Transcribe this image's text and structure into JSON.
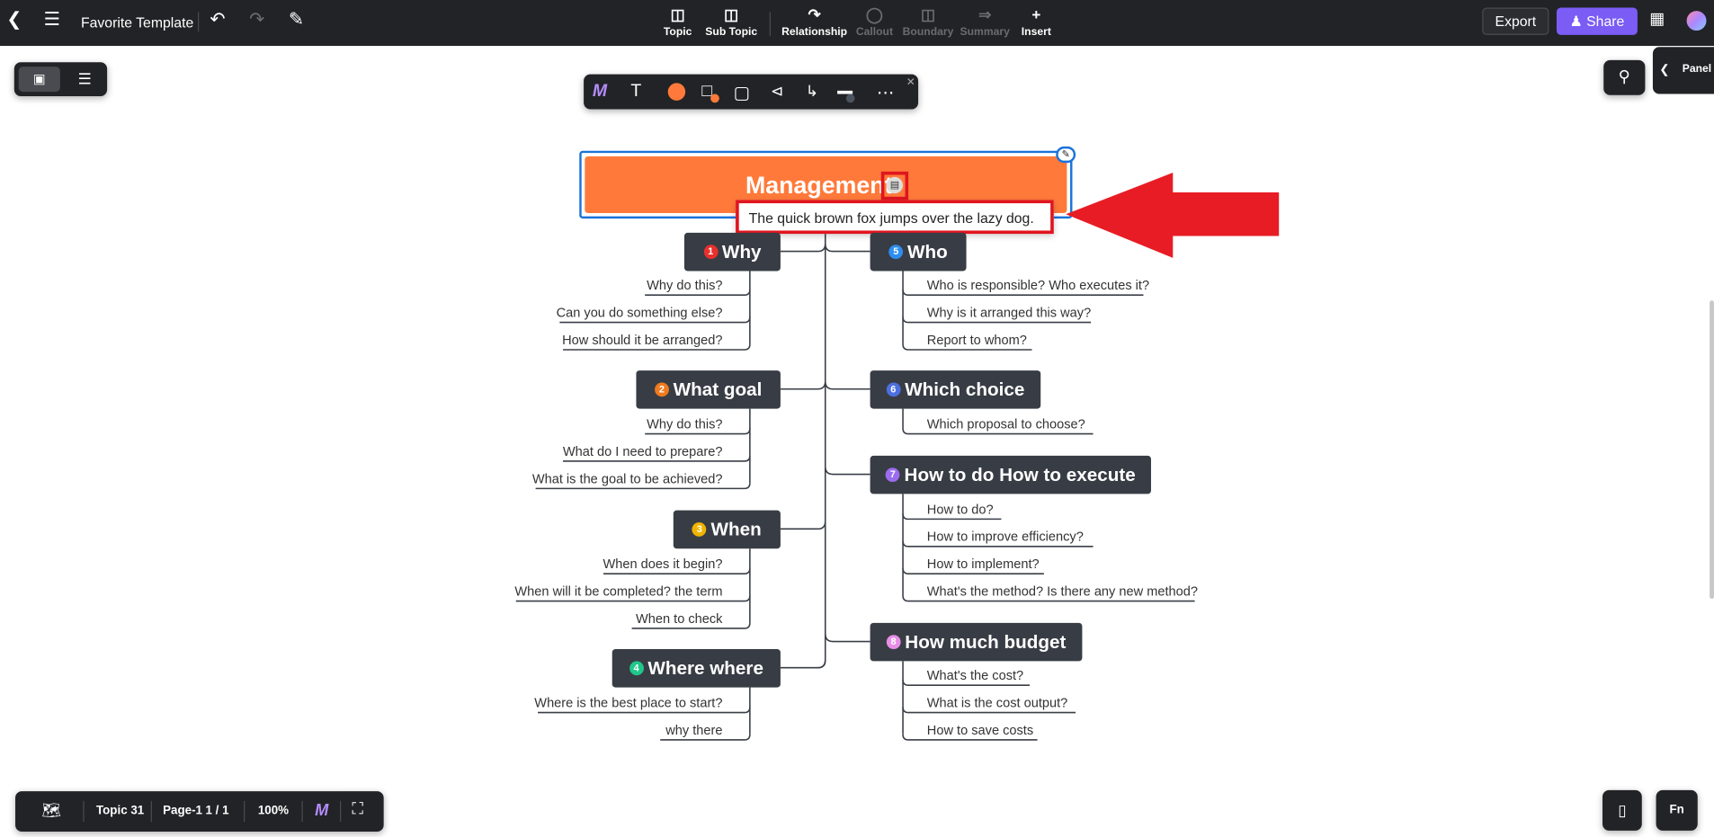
{
  "topbar": {
    "title": "Favorite Template",
    "tools": [
      {
        "label": "Topic",
        "icon": "topic-icon",
        "disabled": false
      },
      {
        "label": "Sub Topic",
        "icon": "subtopic-icon",
        "disabled": false
      },
      {
        "label": "Relationship",
        "icon": "relationship-icon",
        "disabled": false
      },
      {
        "label": "Callout",
        "icon": "callout-icon",
        "disabled": true
      },
      {
        "label": "Boundary",
        "icon": "boundary-icon",
        "disabled": true
      },
      {
        "label": "Summary",
        "icon": "summary-icon",
        "disabled": true
      },
      {
        "label": "Insert",
        "icon": "plus-icon",
        "disabled": false
      }
    ],
    "export": "Export",
    "share": "Share"
  },
  "panel_tab": "Panel",
  "format_toolbar": {
    "fill_color": "#ff7a3a"
  },
  "root": {
    "title": "Management",
    "note": "The quick brown fox jumps over the lazy dog.",
    "color": "#ff7a3a"
  },
  "branches": [
    {
      "num": "1",
      "title": "Why",
      "color": "#e8302c",
      "subs": [
        "Why do this?",
        "Can you do something else?",
        "How should it be arranged?"
      ]
    },
    {
      "num": "2",
      "title": "What goal",
      "color": "#f07a1e",
      "subs": [
        "Why do this?",
        "What do I need to prepare?",
        "What is the goal to be achieved?"
      ]
    },
    {
      "num": "3",
      "title": "When",
      "color": "#f0b400",
      "subs": [
        "When does it begin?",
        "When will it be completed? the term",
        "When to check"
      ]
    },
    {
      "num": "4",
      "title": "Where where",
      "color": "#1fc78a",
      "subs": [
        "Where is the best place to start?",
        "why there"
      ]
    },
    {
      "num": "5",
      "title": "Who",
      "color": "#2d8ef0",
      "subs": [
        "Who is responsible? Who executes it?",
        "Why is it arranged this way?",
        "Report to whom?"
      ]
    },
    {
      "num": "6",
      "title": "Which choice",
      "color": "#4d6fe0",
      "subs": [
        "Which proposal to choose?"
      ]
    },
    {
      "num": "7",
      "title": "How to do How to execute",
      "color": "#9b6cf0",
      "subs": [
        "How to do?",
        "How to improve efficiency?",
        "How to implement?",
        "What's the method? Is there any new method?"
      ]
    },
    {
      "num": "8",
      "title": "How much budget",
      "color": "#e88ee8",
      "subs": [
        "What's the cost?",
        "What is the cost output?",
        "How to save costs"
      ]
    }
  ],
  "bottombar": {
    "topic_count": "Topic 31",
    "page": "Page-1",
    "page_of": "1 / 1",
    "zoom": "100%"
  }
}
